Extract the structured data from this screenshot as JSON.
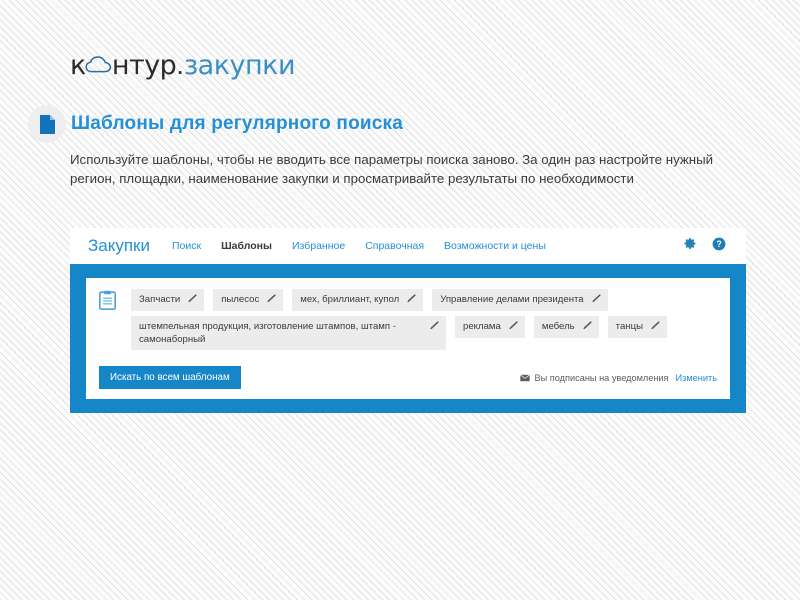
{
  "logo": {
    "prefix": "к",
    "cloud_icon": "cloud-icon",
    "middle": "нтур",
    "dot": ".",
    "suffix": "закупки",
    "accent": "#3a8fc4"
  },
  "heading": {
    "bullet_icon": "document-icon",
    "title": "Шаблоны для регулярного поиска",
    "title_color": "#2390d8"
  },
  "intro": {
    "text": "Используйте шаблоны, чтобы не вводить  все параметры поиска заново. За один раз настройте нужный регион, площадки,  наименование закупки и просматривайте результаты по необходимости"
  },
  "app": {
    "brand": "Закупки",
    "nav": [
      {
        "label": "Поиск",
        "active": false
      },
      {
        "label": "Шаблоны",
        "active": true
      },
      {
        "label": "Избранное",
        "active": false
      },
      {
        "label": "Справочная",
        "active": false
      },
      {
        "label": "Возможности и цены",
        "active": false
      }
    ],
    "header_icons": [
      {
        "name": "gear-icon"
      },
      {
        "name": "help-icon"
      }
    ],
    "card": {
      "list_icon": "clipboard-icon",
      "tag_rows": [
        [
          {
            "label": "Запчасти",
            "edit_icon": "pencil-icon",
            "multiline": false
          },
          {
            "label": "пылесос",
            "edit_icon": "pencil-icon",
            "multiline": false
          },
          {
            "label": "мех, бриллиант, купол",
            "edit_icon": "pencil-icon",
            "multiline": false
          },
          {
            "label": "Управление делами президента",
            "edit_icon": "pencil-icon",
            "multiline": false
          }
        ],
        [
          {
            "label": "штемпельная продукция, изготовление штампов, штамп - самонаборный",
            "edit_icon": "pencil-icon",
            "multiline": true
          },
          {
            "label": "реклама",
            "edit_icon": "pencil-icon",
            "multiline": false
          },
          {
            "label": "мебель",
            "edit_icon": "pencil-icon",
            "multiline": false
          },
          {
            "label": "танцы",
            "edit_icon": "pencil-icon",
            "multiline": false
          }
        ]
      ],
      "search_button": "Искать по всем шаблонам",
      "subscribe_icon": "envelope-icon",
      "subscribe_text": "Вы подписаны на уведомления",
      "change_link": "Изменить"
    },
    "accent": "#1586c8",
    "link_color": "#2390d8"
  }
}
